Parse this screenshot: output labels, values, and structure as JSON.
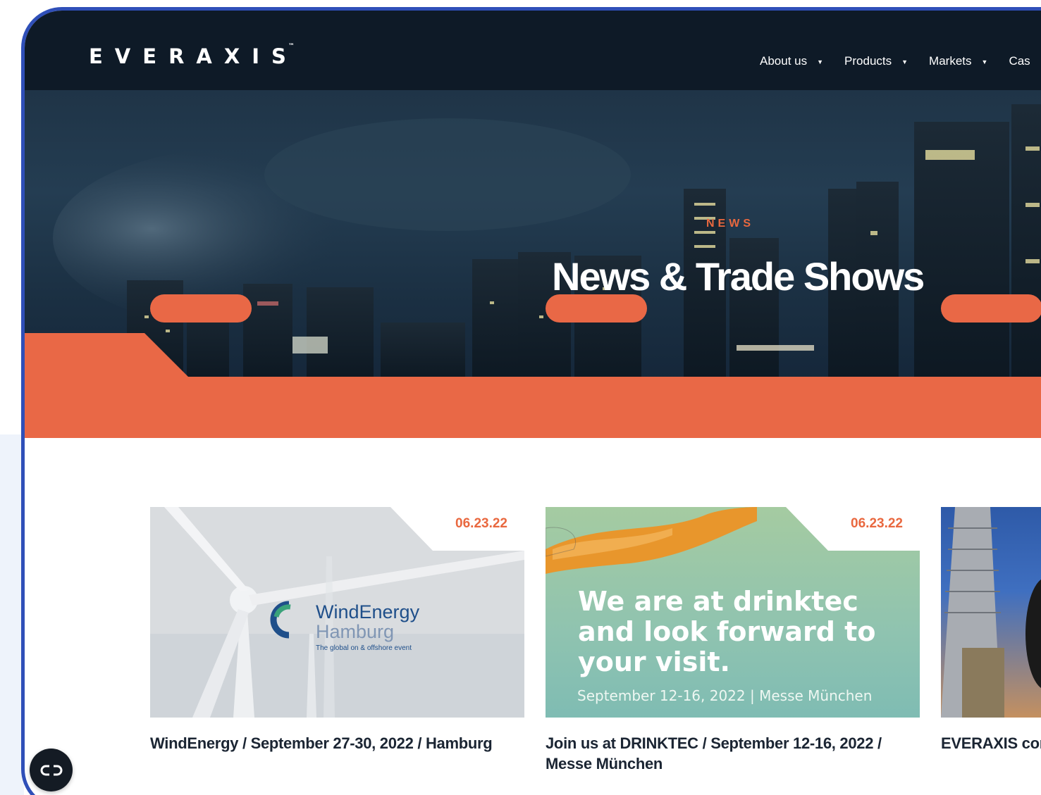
{
  "brand": {
    "logo": "EVERAXIS",
    "trademark": "™"
  },
  "nav": {
    "items": [
      {
        "label": "About us",
        "icon": "caret-down-icon"
      },
      {
        "label": "Products",
        "icon": "caret-down-icon"
      },
      {
        "label": "Markets",
        "icon": "caret-down-icon"
      },
      {
        "label": "Cas"
      }
    ]
  },
  "hero": {
    "eyebrow": "NEWS",
    "title": "News & Trade Shows"
  },
  "cards": [
    {
      "date": "06.23.22",
      "title": "WindEnergy / September 27-30, 2022 / Hamburg",
      "image_text": {
        "line1": "WindEnergy",
        "line2": "Hamburg",
        "line3": "The global on & offshore event"
      }
    },
    {
      "date": "06.23.22",
      "title": "Join us at DRINKTEC / September 12-16, 2022 / Messe München",
      "image_text": {
        "line1": "We are at drinktec",
        "line2": "and look forward to",
        "line3": "your visit.",
        "line4": "September 12-16, 2022 | Messe München"
      }
    },
    {
      "date": "",
      "title": "EVERAXIS cor"
    }
  ],
  "colors": {
    "accent": "#e96846",
    "navy": "#0e1a27",
    "frame": "#2f4fb8",
    "text": "#1b2533"
  },
  "fab": {
    "icon": "accessibility-toggle-icon"
  }
}
